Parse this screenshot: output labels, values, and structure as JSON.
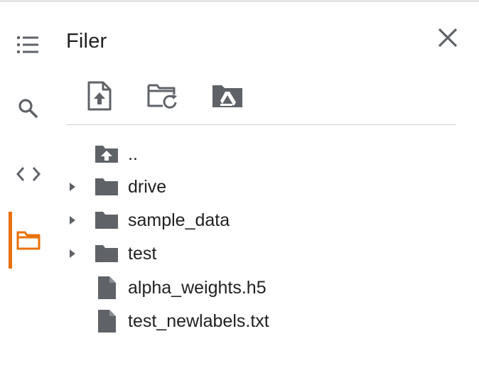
{
  "panel": {
    "title": "Filer"
  },
  "rail": {
    "items": [
      {
        "name": "toc",
        "icon": "list-icon"
      },
      {
        "name": "search",
        "icon": "search-icon"
      },
      {
        "name": "code-snippets",
        "icon": "code-icon"
      },
      {
        "name": "files",
        "icon": "folder-icon",
        "active": true
      }
    ],
    "active_color": "#e8710a"
  },
  "toolbar": {
    "buttons": [
      {
        "icon": "upload-file-icon"
      },
      {
        "icon": "refresh-folder-icon"
      },
      {
        "icon": "google-drive-folder-icon"
      }
    ]
  },
  "tree": {
    "items": [
      {
        "label": "..",
        "type": "parent",
        "icon": "folder-up-icon"
      },
      {
        "label": "drive",
        "type": "folder",
        "icon": "folder-icon"
      },
      {
        "label": "sample_data",
        "type": "folder",
        "icon": "folder-icon"
      },
      {
        "label": "test",
        "type": "folder",
        "icon": "folder-icon"
      },
      {
        "label": "alpha_weights.h5",
        "type": "file",
        "icon": "file-icon"
      },
      {
        "label": "test_newlabels.txt",
        "type": "file",
        "icon": "file-icon"
      }
    ]
  },
  "colors": {
    "icon": "#5f6368",
    "text": "#212121",
    "divider": "#d4d4d4",
    "accent": "#e8710a"
  }
}
